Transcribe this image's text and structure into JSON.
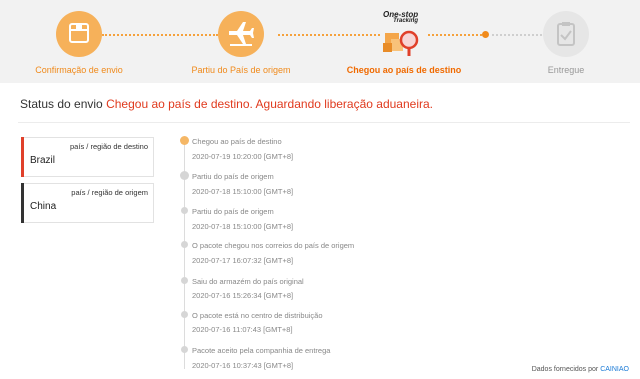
{
  "progress": {
    "steps": [
      {
        "label": "Confirmação de envio",
        "icon": "package-icon",
        "state": "done"
      },
      {
        "label": "Partiu do País de origem",
        "icon": "airplane-icon",
        "state": "done"
      },
      {
        "label": "Chegou ao país de destino",
        "icon": "one-stop-tracking-icon",
        "state": "current"
      },
      {
        "label": "Entregue",
        "icon": "clipboard-check-icon",
        "state": "pending"
      }
    ],
    "badge": {
      "line1": "One-stop",
      "line2": "Tracking"
    },
    "colors": {
      "accent": "#f08a1b",
      "accent_light": "#f6b15a",
      "pending": "#e6e6e6"
    }
  },
  "status": {
    "prefix": "Status do envio",
    "value": "Chegou ao país de destino. Aguardando liberação aduaneira.",
    "value_color": "#e03a1e"
  },
  "cards": [
    {
      "role": "país / região de destino",
      "country": "Brazil",
      "bar_color": "#e0402a"
    },
    {
      "role": "país / região de origem",
      "country": "China",
      "bar_color": "#333333"
    }
  ],
  "timeline": [
    {
      "event": "Chegou ao país de destino",
      "time": "2020-07-19 10:20:00 [GMT+8]",
      "icon": "warehouse-icon"
    },
    {
      "event": "Partiu do país de origem",
      "time": "2020-07-18 15:10:00 [GMT+8]",
      "icon": "airplane-icon"
    },
    {
      "event": "Partiu do país de origem",
      "time": "2020-07-18 15:10:00 [GMT+8]"
    },
    {
      "event": "O pacote chegou nos correios do país de origem",
      "time": "2020-07-17 16:07:32 [GMT+8]"
    },
    {
      "event": "Saiu do armazém do país original",
      "time": "2020-07-16 15:26:34 [GMT+8]"
    },
    {
      "event": "O pacote está no centro de distribuição",
      "time": "2020-07-16 11:07:43 [GMT+8]"
    },
    {
      "event": "Pacote aceito pela companhia de entrega",
      "time": "2020-07-16 10:37:43 [GMT+8]"
    }
  ],
  "footer": {
    "text": "Dados fornecidos por",
    "link": "CAINIAO"
  }
}
